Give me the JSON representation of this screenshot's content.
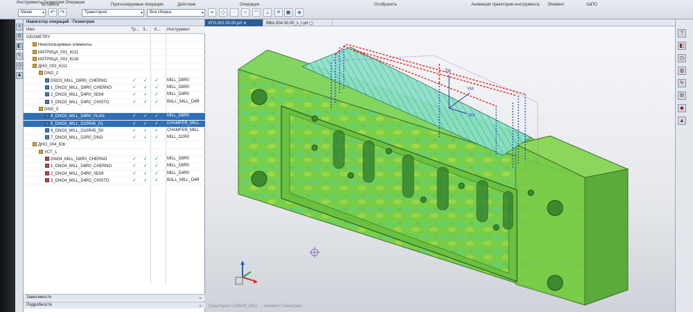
{
  "ribbon": {
    "app_title": "Инструменты Геометрия Операции",
    "groups": [
      "Вставить",
      "Прогнозируемые операции",
      "Действие",
      "Операции",
      "Отобразить",
      "Анимация траектории инструмента",
      "Элемент",
      "ЗаПО"
    ],
    "menu_label": "Меню",
    "filter_value": "Траектория",
    "scope_value": "Вся сборка"
  },
  "navigator": {
    "title": "Навигатор операций - Геометрия",
    "columns": {
      "name": "Имя",
      "c1": "Тр...",
      "c2": "З...",
      "c3": "К...",
      "tool": "Инструмент"
    },
    "rows": [
      {
        "name": "GEOMETRY",
        "indent": 0,
        "icon": "none",
        "c1": false,
        "c2": false,
        "c3": false,
        "tool": "",
        "sel": false
      },
      {
        "name": "Неиспользуемые элементы",
        "indent": 1,
        "icon": "grp",
        "c1": false,
        "c2": false,
        "c3": false,
        "tool": "",
        "sel": false
      },
      {
        "name": "МАТРИЦА_001_Ю11",
        "indent": 1,
        "icon": "grp",
        "c1": false,
        "c2": false,
        "c3": false,
        "tool": "",
        "sel": false
      },
      {
        "name": "МАТРИЦА_002_Ю16",
        "indent": 1,
        "icon": "grp",
        "c1": false,
        "c2": false,
        "c3": false,
        "tool": "",
        "sel": false
      },
      {
        "name": "ДНО_003_Ю11",
        "indent": 1,
        "icon": "grp",
        "c1": false,
        "c2": false,
        "c3": false,
        "tool": "",
        "sel": false
      },
      {
        "name": "DNO_2",
        "indent": 2,
        "icon": "grp",
        "c1": false,
        "c2": false,
        "c3": false,
        "tool": "",
        "sel": false
      },
      {
        "name": "DNO3_MILL_D8R0_CHERNO",
        "indent": 3,
        "icon": "op",
        "c1": true,
        "c2": true,
        "c3": true,
        "tool": "MILL_D8R0",
        "sel": false
      },
      {
        "name": "1_DNO3_MILL_D8R0_CHERNO",
        "indent": 3,
        "icon": "op",
        "c1": true,
        "c2": true,
        "c3": true,
        "tool": "MILL_D8R0",
        "sel": false
      },
      {
        "name": "2_DNO3_MILL_D4R0_SEMI",
        "indent": 3,
        "icon": "op",
        "c1": true,
        "c2": true,
        "c3": true,
        "tool": "MILL_D4R0",
        "sel": false
      },
      {
        "name": "3_DNO3_MILL_D4R2_CHISTO",
        "indent": 3,
        "icon": "op",
        "c1": true,
        "c2": true,
        "c3": true,
        "tool": "BALL_MILL_D4R",
        "sel": false
      },
      {
        "name": "DNO_3",
        "indent": 2,
        "icon": "grp",
        "c1": false,
        "c2": false,
        "c3": false,
        "tool": "",
        "sel": false
      },
      {
        "name": "4_DNO3_MILL_D8R0_PLAN",
        "indent": 3,
        "icon": "op",
        "c1": true,
        "c2": true,
        "c3": true,
        "tool": "MILL_D8R0",
        "sel": true
      },
      {
        "name": "5_DNO3_MILL_D10R45_D1",
        "indent": 3,
        "icon": "op",
        "c1": true,
        "c2": true,
        "c3": true,
        "tool": "CHAMFER_MILL",
        "sel": true
      },
      {
        "name": "6_DNO3_MILL_D10R45_D0",
        "indent": 3,
        "icon": "op",
        "c1": true,
        "c2": true,
        "c3": true,
        "tool": "CHAMFER_MILL",
        "sel": false
      },
      {
        "name": "7_DNO3_MILL_D2R0_DNO",
        "indent": 3,
        "icon": "op",
        "c1": true,
        "c2": true,
        "c3": true,
        "tool": "MILL_D2R0",
        "sel": false
      },
      {
        "name": "ДНО_004_Ю6",
        "indent": 1,
        "icon": "grp",
        "c1": false,
        "c2": false,
        "c3": false,
        "tool": "",
        "sel": false
      },
      {
        "name": "УСТ_1",
        "indent": 2,
        "icon": "grp",
        "c1": false,
        "c2": false,
        "c3": false,
        "tool": "",
        "sel": false
      },
      {
        "name": "DNO4_MILL_D8R0_CHERNO",
        "indent": 3,
        "icon": "opr",
        "c1": true,
        "c2": true,
        "c3": true,
        "tool": "MILL_D8R0",
        "sel": false
      },
      {
        "name": "1_DNO4_MILL_D6R0_CHERNO",
        "indent": 3,
        "icon": "opr",
        "c1": true,
        "c2": true,
        "c3": true,
        "tool": "MILL_D6R0",
        "sel": false
      },
      {
        "name": "2_DNO4_MILL_D4R0_SEMI",
        "indent": 3,
        "icon": "opr",
        "c1": true,
        "c2": true,
        "c3": true,
        "tool": "MILL_D4R0",
        "sel": false
      },
      {
        "name": "3_DNO4_MILL_D4R2_CHISTO",
        "indent": 3,
        "icon": "opr",
        "c1": true,
        "c2": true,
        "c3": true,
        "tool": "BALL_MILL_D4R",
        "sel": false
      }
    ],
    "check_glyph": "✓",
    "panel_dependencies": "Зависимости",
    "panel_details": "Подробности"
  },
  "graphics": {
    "tabs": [
      "VFD.001.00.00.prt",
      "ВФА.004.00.00_s_t.prt"
    ],
    "axis_labels": {
      "zm": "ZM",
      "ym": "YM",
      "xm": "XM"
    },
    "status_text": "Траектория 5-DNO3_MILL ... элемент Геометрия"
  },
  "colors": {
    "part_green": "#6fca4a",
    "path_red": "#e0241b",
    "path_blue": "#1b3fcf",
    "selection_blue": "#2f6fb5"
  }
}
